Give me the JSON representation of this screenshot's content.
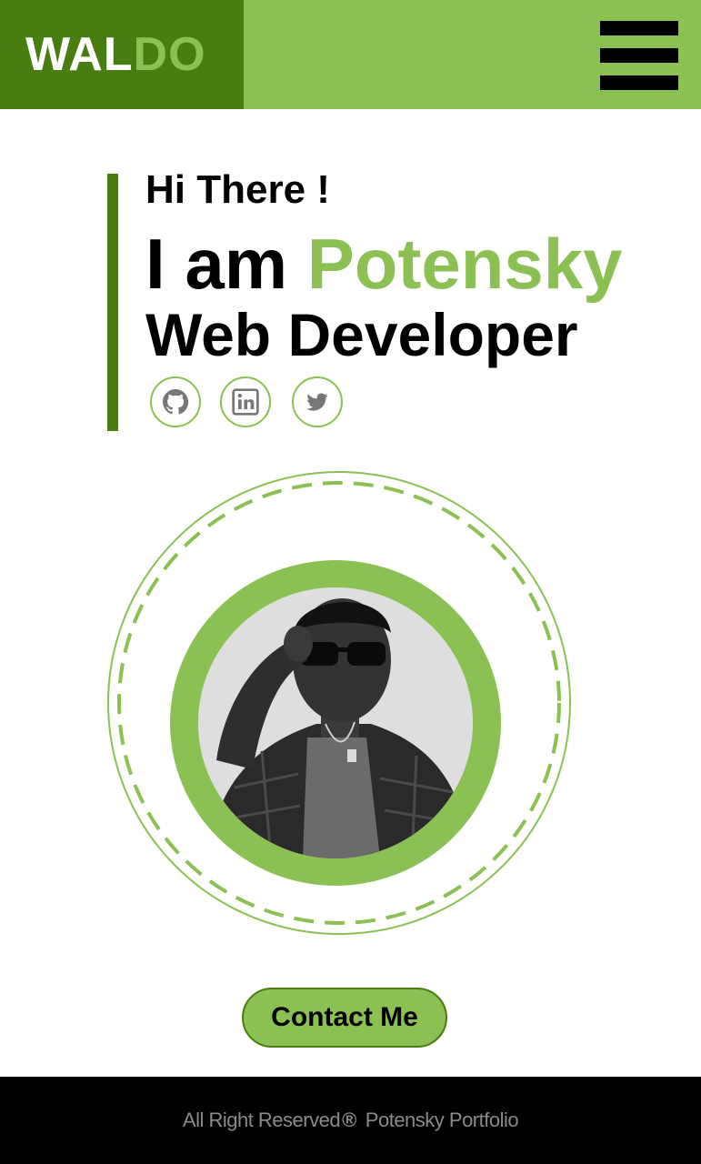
{
  "header": {
    "logo_part1": "WAL",
    "logo_part2": "DO",
    "menu_icon": "hamburger-menu-icon"
  },
  "intro": {
    "greeting": "Hi There !",
    "name_prefix": "I am",
    "name": "Potensky",
    "role": "Web Developer"
  },
  "socials": [
    {
      "icon": "github-icon"
    },
    {
      "icon": "linkedin-icon"
    },
    {
      "icon": "twitter-icon"
    }
  ],
  "cta": {
    "contact_label": "Contact Me"
  },
  "footer": {
    "rights": "All Right Reserved",
    "symbol": "®",
    "owner": "Potensky Portfolio"
  },
  "colors": {
    "accent": "#8bc052",
    "dark_accent": "#4a7d0f",
    "text": "#000000",
    "footer_bg": "#000000",
    "footer_text": "#8a8a8a"
  }
}
